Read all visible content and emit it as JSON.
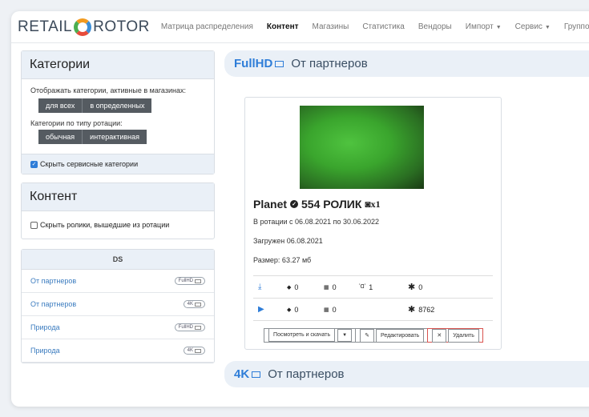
{
  "logo": {
    "left": "RETAIL",
    "right": "ROTOR"
  },
  "nav": [
    {
      "label": "Матрица распределения"
    },
    {
      "label": "Контент",
      "active": true
    },
    {
      "label": "Магазины"
    },
    {
      "label": "Статистика"
    },
    {
      "label": "Вендоры"
    },
    {
      "label": "Импорт",
      "dropdown": true
    },
    {
      "label": "Сервис",
      "dropdown": true
    },
    {
      "label": "Групповы"
    }
  ],
  "sidebar": {
    "categories_title": "Категории",
    "show_active_label": "Отображать категории, активные в магазинах:",
    "show_buttons": [
      "для всех",
      "в определенных"
    ],
    "rotation_label": "Категории по типу ротации:",
    "rotation_buttons": [
      "обычная",
      "интерактивная"
    ],
    "hide_service_label": "Скрыть сервисные категории",
    "content_title": "Контент",
    "hide_out_label": "Скрыть ролики, вышедшие из ротации",
    "ds_title": "DS",
    "ds_items": [
      {
        "label": "От партнеров",
        "badge": "FullHD"
      },
      {
        "label": "От партнеров",
        "badge": "4K"
      },
      {
        "label": "Природа",
        "badge": "FullHD"
      },
      {
        "label": "Природа",
        "badge": "4K"
      }
    ]
  },
  "main": {
    "section1": {
      "res": "FullHD",
      "title": "От партнеров"
    },
    "video": {
      "name": "Planet",
      "count": "554 РОЛИК",
      "multiplier": "x1",
      "rotation": "В ротации с 06.08.2021 по 30.06.2022",
      "uploaded": "Загружен 06.08.2021",
      "size": "Размер: 63.27 мб",
      "stats_row1": {
        "a": "0",
        "b": "0",
        "c": "1",
        "d": "0"
      },
      "stats_row2": {
        "a": "0",
        "b": "0",
        "d": "8762"
      },
      "btn_view": "Посмотреть и скачать",
      "btn_edit": "Редактировать",
      "btn_delete": "Удалить"
    },
    "section2": {
      "res": "4K",
      "title": "От партнеров"
    }
  },
  "icons": [
    "download-icon",
    "play-icon",
    "diamond-icon",
    "windows-icon",
    "signal-icon",
    "asterisk-icon",
    "check-circle-icon",
    "camera-icon",
    "pencil-icon",
    "close-icon",
    "checkbox-icon"
  ],
  "colors": {
    "accent": "#2e7dd8",
    "danger": "#d9534f",
    "panel": "#eaf0f7"
  }
}
